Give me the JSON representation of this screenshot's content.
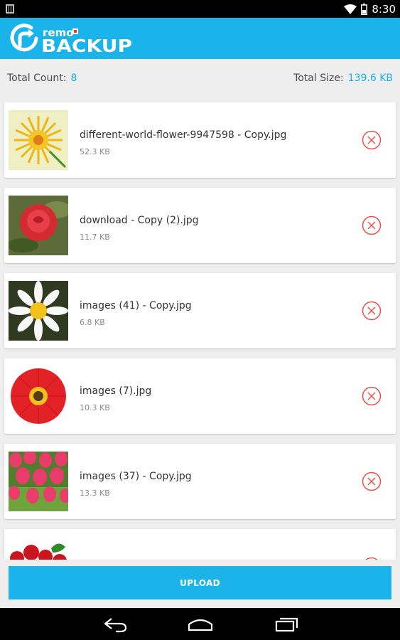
{
  "status_bar": {
    "time": "8:30",
    "icons": [
      "sim-icon",
      "wifi-icon",
      "battery-icon"
    ]
  },
  "app_bar": {
    "brand_small": "remo",
    "brand_large": "BACKUP",
    "brand_color": "#1ab3ea",
    "accent_color": "#e8322b"
  },
  "summary": {
    "count_label": "Total Count:",
    "count_value": "8",
    "size_label": "Total Size:",
    "size_value": "139.6 KB"
  },
  "files": [
    {
      "name": "different-world-flower-9947598 - Copy.jpg",
      "size": "52.3 KB",
      "thumb": "yellow-flower-icon",
      "remove_icon": "remove-circle-icon"
    },
    {
      "name": "download - Copy (2).jpg",
      "size": "11.7 KB",
      "thumb": "red-rose-icon",
      "remove_icon": "remove-circle-icon"
    },
    {
      "name": "images (41) - Copy.jpg",
      "size": "6.8 KB",
      "thumb": "white-daisy-icon",
      "remove_icon": "remove-circle-icon"
    },
    {
      "name": "images (7).jpg",
      "size": "10.3 KB",
      "thumb": "red-gerbera-icon",
      "remove_icon": "remove-circle-icon"
    },
    {
      "name": "images (37) - Copy.jpg",
      "size": "13.3 KB",
      "thumb": "pink-tulips-icon",
      "remove_icon": "remove-circle-icon"
    },
    {
      "name": "",
      "size": "",
      "thumb": "red-roses-bouquet-icon",
      "remove_icon": "remove-circle-icon"
    }
  ],
  "upload": {
    "label": "UPLOAD"
  },
  "nav_bar": {
    "icons": [
      "back-icon",
      "home-icon",
      "recent-apps-icon"
    ]
  }
}
